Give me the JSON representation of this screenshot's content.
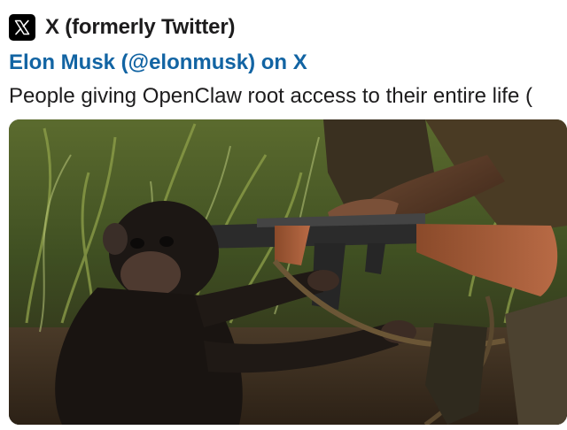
{
  "source": {
    "name": "X (formerly Twitter)",
    "icon": "x-logo-icon"
  },
  "author": {
    "link_text": "Elon Musk (@elonmusk) on X"
  },
  "tweet": {
    "text": "People giving OpenClaw root access to their entire life ("
  },
  "media": {
    "description_icon": "image-chimp-handed-rifle"
  },
  "colors": {
    "link": "#1264a3",
    "text": "#1d1c1d",
    "logo_bg": "#000000"
  }
}
